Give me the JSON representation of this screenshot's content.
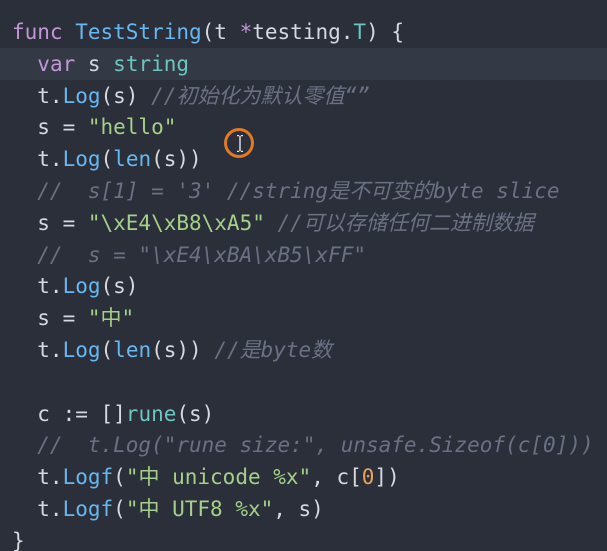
{
  "editor": {
    "lines": [
      {
        "tokens": [
          {
            "text": "func ",
            "kind": "kw"
          },
          {
            "text": "TestString",
            "kind": "fn"
          },
          {
            "text": "(t ",
            "kind": "tx"
          },
          {
            "text": "*",
            "kind": "kw"
          },
          {
            "text": "testing.",
            "kind": "tx"
          },
          {
            "text": "T",
            "kind": "type"
          },
          {
            "text": ") {",
            "kind": "tx"
          }
        ]
      },
      {
        "tokens": [
          {
            "text": "  ",
            "kind": "tx"
          },
          {
            "text": "var",
            "kind": "kw"
          },
          {
            "text": " s ",
            "kind": "tx"
          },
          {
            "text": "string",
            "kind": "type"
          }
        ]
      },
      {
        "tokens": [
          {
            "text": "  t.",
            "kind": "tx"
          },
          {
            "text": "Log",
            "kind": "fn"
          },
          {
            "text": "(s) ",
            "kind": "tx"
          },
          {
            "text": "//初始化为默认零值“”",
            "kind": "cm"
          }
        ]
      },
      {
        "tokens": [
          {
            "text": "  s = ",
            "kind": "tx"
          },
          {
            "text": "\"hello\"",
            "kind": "str"
          }
        ]
      },
      {
        "tokens": [
          {
            "text": "  t.",
            "kind": "tx"
          },
          {
            "text": "Log",
            "kind": "fn"
          },
          {
            "text": "(",
            "kind": "tx"
          },
          {
            "text": "len",
            "kind": "fn"
          },
          {
            "text": "(s))",
            "kind": "tx"
          }
        ]
      },
      {
        "tokens": [
          {
            "text": "  //  s[1] = '3' //string是不可变的byte slice",
            "kind": "cm"
          }
        ]
      },
      {
        "tokens": [
          {
            "text": "  s = ",
            "kind": "tx"
          },
          {
            "text": "\"\\xE4\\xB8\\xA5\"",
            "kind": "str"
          },
          {
            "text": " ",
            "kind": "tx"
          },
          {
            "text": "//可以存储任何二进制数据",
            "kind": "cm"
          }
        ]
      },
      {
        "tokens": [
          {
            "text": "  //  s = \"\\xE4\\xBA\\xB5\\xFF\"",
            "kind": "cm"
          }
        ]
      },
      {
        "tokens": [
          {
            "text": "  t.",
            "kind": "tx"
          },
          {
            "text": "Log",
            "kind": "fn"
          },
          {
            "text": "(s)",
            "kind": "tx"
          }
        ]
      },
      {
        "tokens": [
          {
            "text": "  s = ",
            "kind": "tx"
          },
          {
            "text": "\"中\"",
            "kind": "str"
          }
        ]
      },
      {
        "tokens": [
          {
            "text": "  t.",
            "kind": "tx"
          },
          {
            "text": "Log",
            "kind": "fn"
          },
          {
            "text": "(",
            "kind": "tx"
          },
          {
            "text": "len",
            "kind": "fn"
          },
          {
            "text": "(s)) ",
            "kind": "tx"
          },
          {
            "text": "//是byte数",
            "kind": "cm"
          }
        ]
      },
      {
        "tokens": []
      },
      {
        "tokens": [
          {
            "text": "  c := []",
            "kind": "tx"
          },
          {
            "text": "rune",
            "kind": "type"
          },
          {
            "text": "(s)",
            "kind": "tx"
          }
        ]
      },
      {
        "tokens": [
          {
            "text": "  //  t.Log(\"rune size:\", unsafe.Sizeof(c[0]))",
            "kind": "cm"
          }
        ]
      },
      {
        "tokens": [
          {
            "text": "  t.",
            "kind": "tx"
          },
          {
            "text": "Logf",
            "kind": "fn"
          },
          {
            "text": "(",
            "kind": "tx"
          },
          {
            "text": "\"中 unicode %x\"",
            "kind": "str"
          },
          {
            "text": ", c[",
            "kind": "tx"
          },
          {
            "text": "0",
            "kind": "num"
          },
          {
            "text": "])",
            "kind": "tx"
          }
        ]
      },
      {
        "tokens": [
          {
            "text": "  t.",
            "kind": "tx"
          },
          {
            "text": "Logf",
            "kind": "fn"
          },
          {
            "text": "(",
            "kind": "tx"
          },
          {
            "text": "\"中 UTF8 %x\"",
            "kind": "str"
          },
          {
            "text": ", s)",
            "kind": "tx"
          }
        ]
      },
      {
        "tokens": [
          {
            "text": "}",
            "kind": "tx"
          }
        ]
      }
    ],
    "active_line": 1,
    "colors": {
      "background": "#2b2f3a",
      "active_line": "#343946",
      "keyword": "#c396d8",
      "function": "#67b7f0",
      "string": "#a6d08a",
      "number": "#e7a25c",
      "type": "#6cc5c0",
      "text": "#d6d9df",
      "comment": "#6a7184",
      "cursor_ring": "#e07a24"
    }
  },
  "cursor": {
    "icon": "text-ibeam-icon"
  }
}
